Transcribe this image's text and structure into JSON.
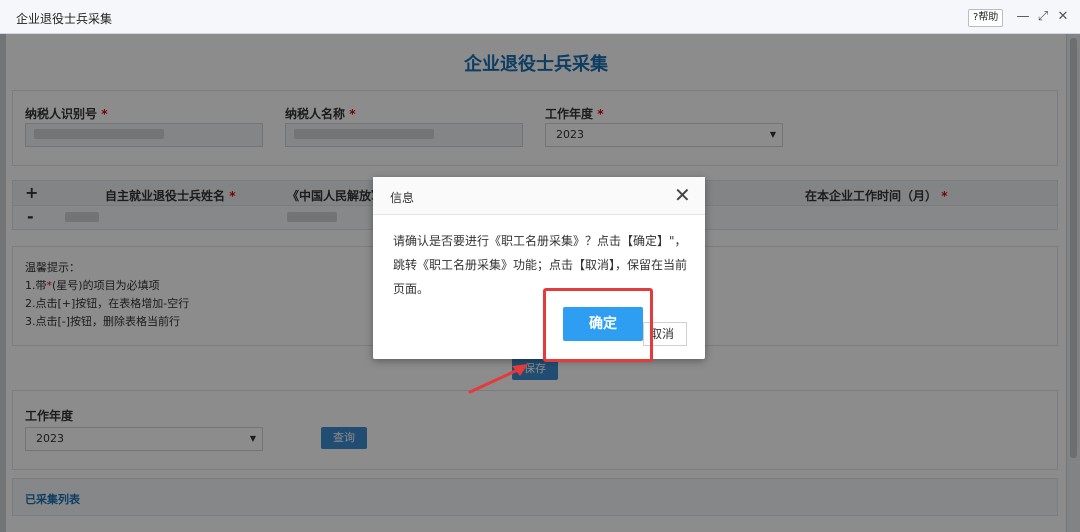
{
  "window": {
    "title": "企业退役士兵采集",
    "help_label": "帮助",
    "help_glyph": "?",
    "min_glyph": "—",
    "max_glyph": "⤢",
    "close_glyph": "✕"
  },
  "page": {
    "title": "企业退役士兵采集"
  },
  "form": {
    "taxpayer_id_label": "纳税人识别号",
    "taxpayer_name_label": "纳税人名称",
    "work_year_label": "工作年度",
    "required_mark": "*",
    "work_year_value": "2023"
  },
  "table": {
    "plus": "+",
    "minus": "-",
    "col_name": "自主就业退役士兵姓名",
    "col_cert": "《中国人民解放军",
    "col_months": "在本企业工作时间（月）"
  },
  "tips": {
    "title": "温馨提示：",
    "line1_pre": "1.带",
    "line1_post": "(星号)的项目为必填项",
    "line2": "2.点击[+]按钮，在表格增加-空行",
    "line3": "3.点击[-]按钮，删除表格当前行"
  },
  "buttons": {
    "save": "保存",
    "query": "查询"
  },
  "query": {
    "year_label": "工作年度",
    "year_value": "2023"
  },
  "list": {
    "title": "已采集列表"
  },
  "dialog": {
    "title": "信息",
    "close_glyph": "✕",
    "message": "请确认是否要进行《职工名册采集》？点击【确定】\"，跳转《职工名册采集》功能；点击【取消】，保留在当前页面。",
    "ok_label": "确定",
    "cancel_label": "取消"
  },
  "colors": {
    "accent": "#1a6fb3",
    "button_blue": "#2d9ef2",
    "highlight_red": "#e53a3a"
  }
}
